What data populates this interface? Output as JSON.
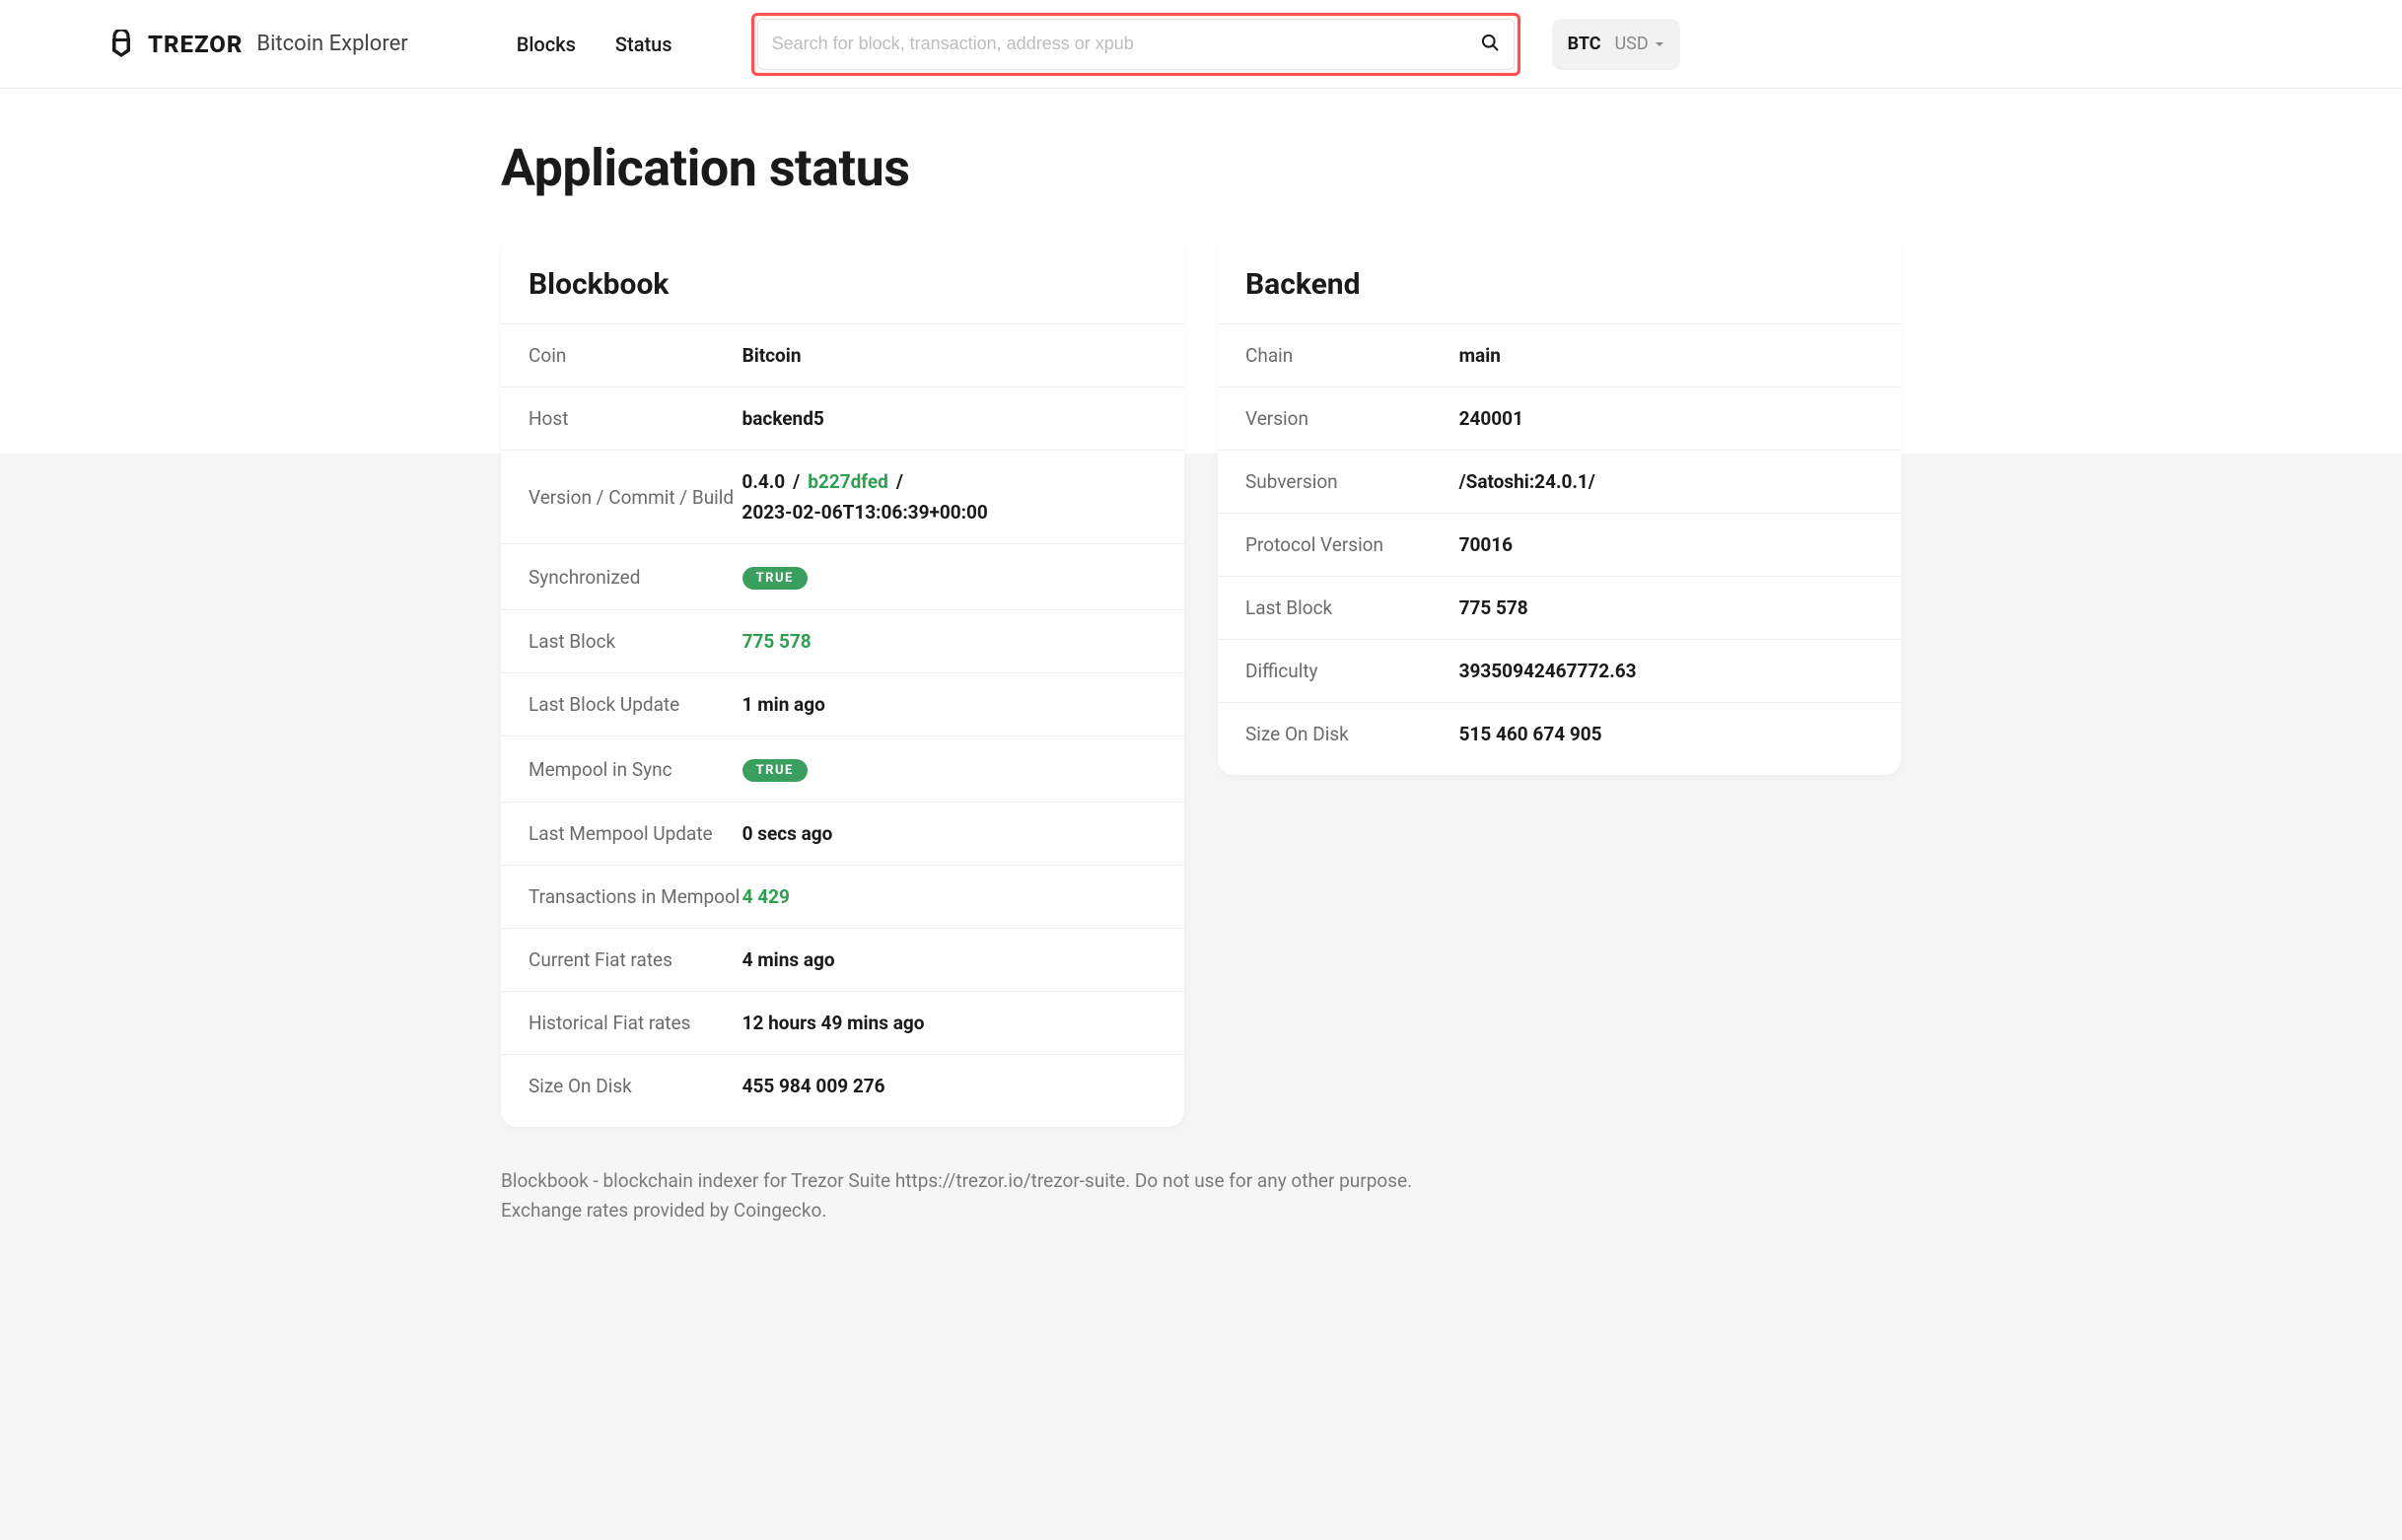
{
  "header": {
    "brand": "TREZOR",
    "subtitle": "Bitcoin Explorer",
    "nav": {
      "blocks": "Blocks",
      "status": "Status"
    },
    "search_placeholder": "Search for block, transaction, address or xpub",
    "currency_primary": "BTC",
    "currency_secondary": "USD"
  },
  "page_title": "Application status",
  "blockbook": {
    "heading": "Blockbook",
    "labels": {
      "coin": "Coin",
      "host": "Host",
      "version": "Version / Commit / Build",
      "synchronized": "Synchronized",
      "last_block": "Last Block",
      "last_block_update": "Last Block Update",
      "mempool_sync": "Mempool in Sync",
      "last_mempool_update": "Last Mempool Update",
      "tx_in_mempool": "Transactions in Mempool",
      "current_fiat": "Current Fiat rates",
      "historical_fiat": "Historical Fiat rates",
      "size_on_disk": "Size On Disk"
    },
    "values": {
      "coin": "Bitcoin",
      "host": "backend5",
      "version": "0.4.0",
      "commit": "b227dfed",
      "build": "2023-02-06T13:06:39+00:00",
      "synchronized": "TRUE",
      "last_block": "775 578",
      "last_block_update": "1 min ago",
      "mempool_sync": "TRUE",
      "last_mempool_update": "0 secs ago",
      "tx_in_mempool": "4 429",
      "current_fiat": "4 mins ago",
      "historical_fiat": "12 hours 49 mins ago",
      "size_on_disk": "455 984 009 276"
    }
  },
  "backend": {
    "heading": "Backend",
    "labels": {
      "chain": "Chain",
      "version": "Version",
      "subversion": "Subversion",
      "protocol": "Protocol Version",
      "last_block": "Last Block",
      "difficulty": "Difficulty",
      "size_on_disk": "Size On Disk"
    },
    "values": {
      "chain": "main",
      "version": "240001",
      "subversion": "/Satoshi:24.0.1/",
      "protocol": "70016",
      "last_block": "775 578",
      "difficulty": "39350942467772.63",
      "size_on_disk": "515 460 674 905"
    }
  },
  "footer": {
    "line1": "Blockbook - blockchain indexer for Trezor Suite https://trezor.io/trezor-suite. Do not use for any other purpose.",
    "line2": "Exchange rates provided by Coingecko."
  }
}
